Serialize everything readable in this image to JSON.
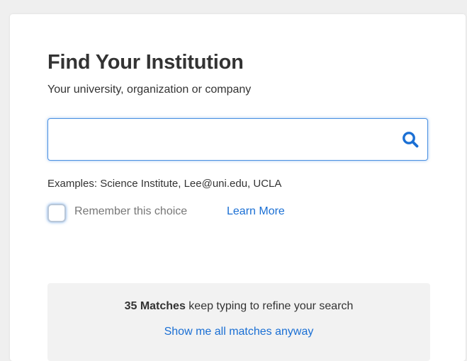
{
  "header": {
    "title": "Find Your Institution",
    "subtitle": "Your university, organization or company"
  },
  "search": {
    "value": "",
    "placeholder": "",
    "icon": "search-icon",
    "accent_color": "#1a6fd4"
  },
  "examples_text": "Examples: Science Institute, Lee@uni.edu, UCLA",
  "remember": {
    "label": "Remember this choice",
    "checked": false,
    "learn_more_label": "Learn More"
  },
  "matches": {
    "count_label": "35 Matches",
    "hint": " keep typing to refine your search",
    "show_all_label": "Show me all matches anyway"
  },
  "colors": {
    "link": "#1a6fd4",
    "focus_border": "#4a90e2",
    "panel_bg": "#f2f2f2"
  }
}
